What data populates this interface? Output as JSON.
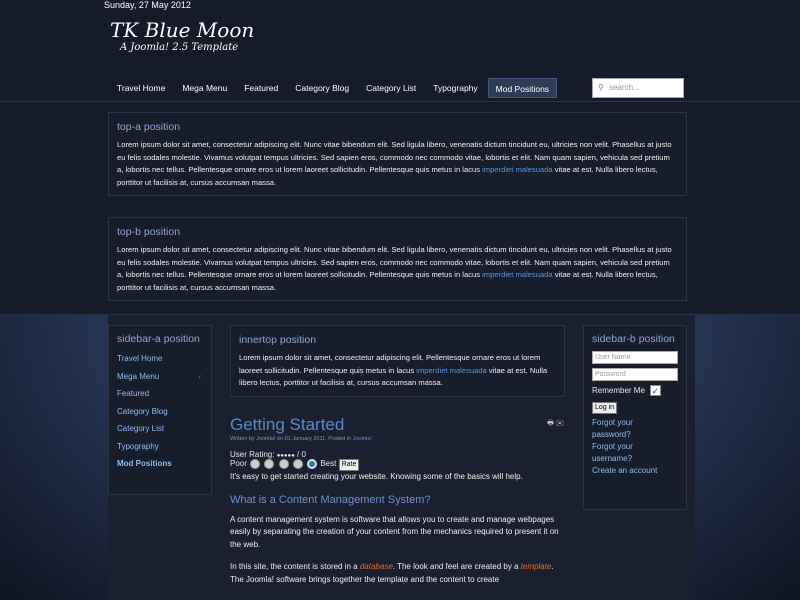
{
  "header": {
    "date": "Sunday, 27 May 2012",
    "logo_title": "TK Blue Moon",
    "logo_subtitle": "A Joomla! 2.5 Template",
    "search_placeholder": "search..."
  },
  "nav": [
    "Travel Home",
    "Mega Menu",
    "Featured",
    "Category Blog",
    "Category List",
    "Typography",
    "Mod Positions"
  ],
  "top_a": {
    "title": "top-a position",
    "text1": "Lorem ipsum dolor sit amet, consectetur adipiscing elit. Nunc vitae bibendum elit. Sed ligula libero, venenatis dictum tincidunt eu, ultricies non velit. Phasellus at justo eu felis sodales molestie. Vivamus volutpat tempus ultricies. Sed sapien eros, commodo nec commodo vitae, lobortis et elit. Nam quam sapien, vehicula sed pretium a, lobortis nec tellus. Pellentesque ornare eros ut lorem laoreet sollicitudin. Pellentesque quis metus in lacus ",
    "link": "imperdiet malesuada",
    "text2": " vitae at est. Nulla libero lectus, porttitor ut facilisis at, cursus accumsan massa."
  },
  "top_b": {
    "title": "top-b position",
    "text1": "Lorem ipsum dolor sit amet, consectetur adipiscing elit. Nunc vitae bibendum elit. Sed ligula libero, venenatis dictum tincidunt eu, ultricies non velit. Phasellus at justo eu felis sodales molestie. Vivamus volutpat tempus ultricies. Sed sapien eros, commodo nec commodo vitae, lobortis et elit. Nam quam sapien, vehicula sed pretium a, lobortis nec tellus. Pellentesque ornare eros ut lorem laoreet sollicitudin. Pellentesque quis metus in lacus ",
    "link": "imperdiet malesuada",
    "text2": " vitae at est. Nulla libero lectus, porttitor ut facilisis at, cursus accumsan massa."
  },
  "sidebar_a": {
    "title": "sidebar-a position",
    "items": [
      "Travel Home",
      "Mega Menu",
      "Featured",
      "Category Blog",
      "Category List",
      "Typography",
      "Mod Positions"
    ],
    "submenu_indicator": "‹"
  },
  "innertop": {
    "title": "innertop position",
    "text1": "Lorem ipsum dolor sit amet, consectetur adipiscing elit.  Pellentesque ornare eros ut lorem laoreet sollicitudin. Pellentesque quis metus in lacus ",
    "link": "imperdiet malesuada",
    "text2": " vitae at est. Nulla libero lectus, porttitor ut facilisis at, cursus accumsan massa."
  },
  "sidebar_b": {
    "title": "sidebar-b position",
    "username_placeholder": "User Name",
    "password_placeholder": "Password",
    "remember": "Remember Me",
    "remember_checked": true,
    "login": "Log in",
    "forgot_password": "Forgot your password?",
    "forgot_username": "Forgot your username?",
    "create": "Create an account"
  },
  "article": {
    "title": "Getting Started",
    "meta_prefix": "Written by Joomla! on 01 January 2011. Posted in ",
    "meta_link": "Joomla!",
    "rating_label": "User Rating: ",
    "rating_stars": "●●●●●",
    "rating_value": " / 0",
    "poor": "Poor",
    "best": "Best",
    "rate": "Rate",
    "selected_rating": 5,
    "intro": "It's easy to get started creating your website. Knowing some of the basics will help.",
    "h2": "What is a Content Management System?",
    "p1": "A content management system is software that allows you to create and manage webpages easily by separating the creation of your content from the mechanics required to present it on the web.",
    "p2a": "In this site, the content is stored in a ",
    "p2link1": "database",
    "p2b": ". The look and feel are created by a ",
    "p2link2": "template",
    "p2c": ". The Joomla! software brings together the template and the content to create"
  }
}
